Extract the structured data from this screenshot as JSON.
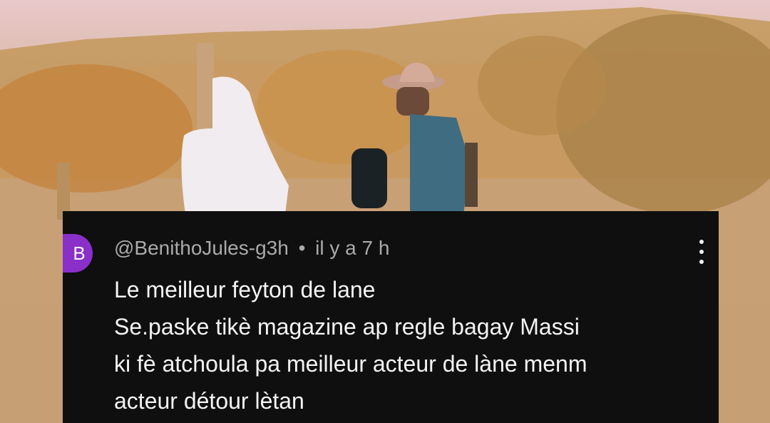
{
  "comment": {
    "avatar_letter": "B",
    "author": "@BenithoJules-g3h",
    "separator": "•",
    "time": "il y a 7 h",
    "lines": [
      "Le meilleur feyton de lane",
      "Se.paske tikè magazine ap regle bagay Massi",
      "ki fè atchoula pa meilleur acteur de làne menm",
      "acteur détour lètan"
    ]
  },
  "colors": {
    "card_bg": "#0f0f0f",
    "avatar_bg": "#8b2fc9",
    "meta_text": "#aaaaaa",
    "body_text": "#f4f4f4"
  },
  "icons": [
    "more-vert-icon"
  ]
}
